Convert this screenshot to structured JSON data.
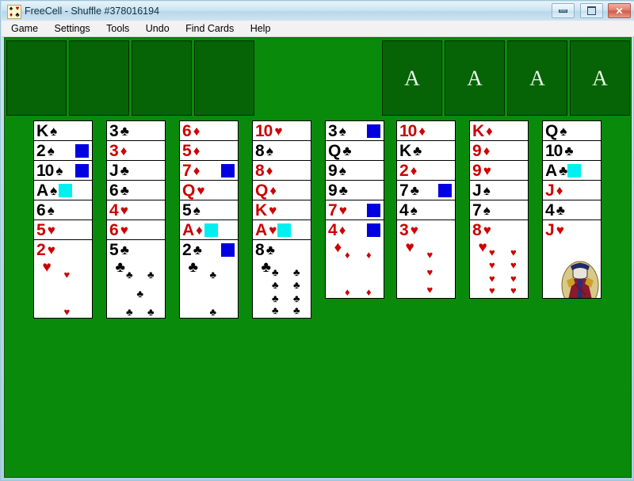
{
  "window": {
    "title": "FreeCell  -  Shuffle #378016194",
    "icon_name": "freecell-icon",
    "buttons": {
      "minimize": "minimize",
      "maximize": "maximize",
      "close": "✕"
    }
  },
  "menu": {
    "items": [
      "Game",
      "Settings",
      "Tools",
      "Undo",
      "Find Cards",
      "Help"
    ]
  },
  "colors": {
    "felt": "#0a8a0a",
    "slot": "#066406",
    "card_red": "#cc0000",
    "card_black": "#000000",
    "marker_blue": "#0000e0",
    "marker_cyan": "#00f0f0"
  },
  "board": {
    "free_cells": [
      {
        "name": "free-cell-1",
        "card": null
      },
      {
        "name": "free-cell-2",
        "card": null
      },
      {
        "name": "free-cell-3",
        "card": null
      },
      {
        "name": "free-cell-4",
        "card": null
      }
    ],
    "foundations": [
      {
        "name": "foundation-1",
        "placeholder": "A",
        "card": null
      },
      {
        "name": "foundation-2",
        "placeholder": "A",
        "card": null
      },
      {
        "name": "foundation-3",
        "placeholder": "A",
        "card": null
      },
      {
        "name": "foundation-4",
        "placeholder": "A",
        "card": null
      }
    ],
    "columns": [
      {
        "name": "tableau-column-1",
        "cards": [
          {
            "rank": "K",
            "suit": "♠",
            "color": "black",
            "marker": null
          },
          {
            "rank": "2",
            "suit": "♠",
            "color": "black",
            "marker": "blue"
          },
          {
            "rank": "10",
            "suit": "♠",
            "color": "black",
            "marker": "blue"
          },
          {
            "rank": "A",
            "suit": "♠",
            "color": "black",
            "marker": "cyan"
          },
          {
            "rank": "6",
            "suit": "♠",
            "color": "black",
            "marker": null
          },
          {
            "rank": "5",
            "suit": "♥",
            "color": "red",
            "marker": null
          },
          {
            "rank": "2",
            "suit": "♥",
            "color": "red",
            "marker": null
          }
        ]
      },
      {
        "name": "tableau-column-2",
        "cards": [
          {
            "rank": "3",
            "suit": "♣",
            "color": "black",
            "marker": null
          },
          {
            "rank": "3",
            "suit": "♦",
            "color": "red",
            "marker": null
          },
          {
            "rank": "J",
            "suit": "♣",
            "color": "black",
            "marker": null
          },
          {
            "rank": "6",
            "suit": "♣",
            "color": "black",
            "marker": null
          },
          {
            "rank": "4",
            "suit": "♥",
            "color": "red",
            "marker": null
          },
          {
            "rank": "6",
            "suit": "♥",
            "color": "red",
            "marker": null
          },
          {
            "rank": "5",
            "suit": "♣",
            "color": "black",
            "marker": null
          }
        ]
      },
      {
        "name": "tableau-column-3",
        "cards": [
          {
            "rank": "6",
            "suit": "♦",
            "color": "red",
            "marker": null
          },
          {
            "rank": "5",
            "suit": "♦",
            "color": "red",
            "marker": null
          },
          {
            "rank": "7",
            "suit": "♦",
            "color": "red",
            "marker": "blue"
          },
          {
            "rank": "Q",
            "suit": "♥",
            "color": "red",
            "marker": null
          },
          {
            "rank": "5",
            "suit": "♠",
            "color": "black",
            "marker": null
          },
          {
            "rank": "A",
            "suit": "♦",
            "color": "red",
            "marker": "cyan"
          },
          {
            "rank": "2",
            "suit": "♣",
            "color": "black",
            "marker": "blue"
          }
        ]
      },
      {
        "name": "tableau-column-4",
        "cards": [
          {
            "rank": "10",
            "suit": "♥",
            "color": "red",
            "marker": null
          },
          {
            "rank": "8",
            "suit": "♠",
            "color": "black",
            "marker": null
          },
          {
            "rank": "8",
            "suit": "♦",
            "color": "red",
            "marker": null
          },
          {
            "rank": "Q",
            "suit": "♦",
            "color": "red",
            "marker": null
          },
          {
            "rank": "K",
            "suit": "♥",
            "color": "red",
            "marker": null
          },
          {
            "rank": "A",
            "suit": "♥",
            "color": "red",
            "marker": "cyan"
          },
          {
            "rank": "8",
            "suit": "♣",
            "color": "black",
            "marker": null
          }
        ]
      },
      {
        "name": "tableau-column-5",
        "cards": [
          {
            "rank": "3",
            "suit": "♠",
            "color": "black",
            "marker": "blue"
          },
          {
            "rank": "Q",
            "suit": "♣",
            "color": "black",
            "marker": null
          },
          {
            "rank": "9",
            "suit": "♠",
            "color": "black",
            "marker": null
          },
          {
            "rank": "9",
            "suit": "♣",
            "color": "black",
            "marker": null
          },
          {
            "rank": "7",
            "suit": "♥",
            "color": "red",
            "marker": "blue"
          },
          {
            "rank": "4",
            "suit": "♦",
            "color": "red",
            "marker": "blue"
          }
        ]
      },
      {
        "name": "tableau-column-6",
        "cards": [
          {
            "rank": "10",
            "suit": "♦",
            "color": "red",
            "marker": null
          },
          {
            "rank": "K",
            "suit": "♣",
            "color": "black",
            "marker": null
          },
          {
            "rank": "2",
            "suit": "♦",
            "color": "red",
            "marker": null
          },
          {
            "rank": "7",
            "suit": "♣",
            "color": "black",
            "marker": "blue"
          },
          {
            "rank": "4",
            "suit": "♠",
            "color": "black",
            "marker": null
          },
          {
            "rank": "3",
            "suit": "♥",
            "color": "red",
            "marker": null
          }
        ]
      },
      {
        "name": "tableau-column-7",
        "cards": [
          {
            "rank": "K",
            "suit": "♦",
            "color": "red",
            "marker": null
          },
          {
            "rank": "9",
            "suit": "♦",
            "color": "red",
            "marker": null
          },
          {
            "rank": "9",
            "suit": "♥",
            "color": "red",
            "marker": null
          },
          {
            "rank": "J",
            "suit": "♠",
            "color": "black",
            "marker": null
          },
          {
            "rank": "7",
            "suit": "♠",
            "color": "black",
            "marker": null
          },
          {
            "rank": "8",
            "suit": "♥",
            "color": "red",
            "marker": null
          }
        ]
      },
      {
        "name": "tableau-column-8",
        "cards": [
          {
            "rank": "Q",
            "suit": "♠",
            "color": "black",
            "marker": null
          },
          {
            "rank": "10",
            "suit": "♣",
            "color": "black",
            "marker": null
          },
          {
            "rank": "A",
            "suit": "♣",
            "color": "black",
            "marker": "cyan"
          },
          {
            "rank": "J",
            "suit": "♦",
            "color": "red",
            "marker": null
          },
          {
            "rank": "4",
            "suit": "♣",
            "color": "black",
            "marker": null
          },
          {
            "rank": "J",
            "suit": "♥",
            "color": "red",
            "marker": null
          }
        ]
      }
    ]
  }
}
